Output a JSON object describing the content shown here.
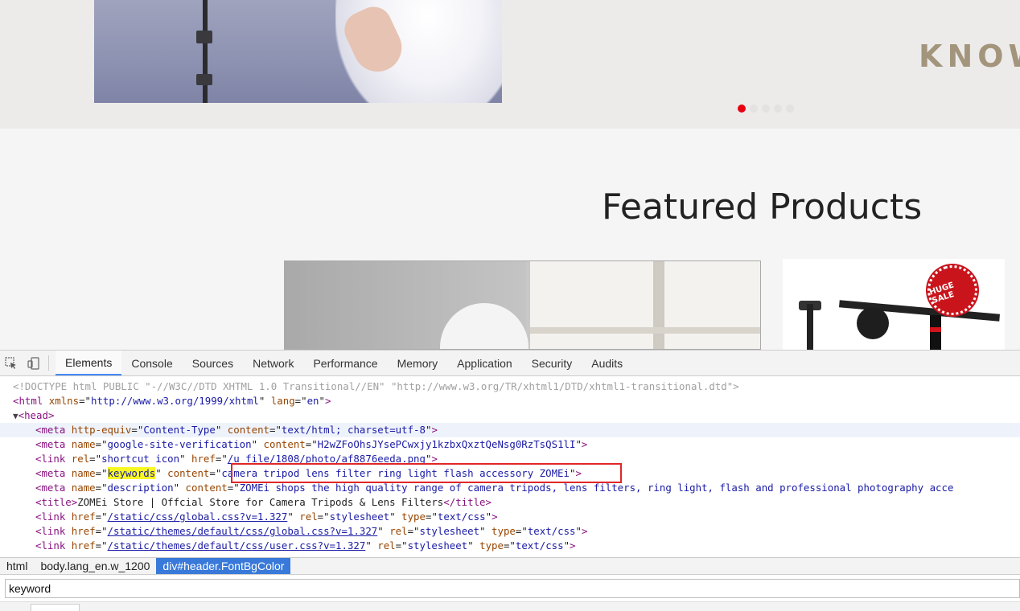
{
  "website": {
    "banner_text": "KNOW",
    "carousel_count": 5,
    "carousel_active": 1,
    "featured_title": "Featured Products",
    "badge_text": "HUGE SALE"
  },
  "devtools": {
    "tabs": [
      {
        "label": "Elements",
        "active": true
      },
      {
        "label": "Console"
      },
      {
        "label": "Sources"
      },
      {
        "label": "Network"
      },
      {
        "label": "Performance"
      },
      {
        "label": "Memory"
      },
      {
        "label": "Application"
      },
      {
        "label": "Security"
      },
      {
        "label": "Audits"
      }
    ],
    "icons": {
      "inspect": "inspect-element-icon",
      "device": "device-toolbar-icon"
    },
    "code": {
      "doctype": "<!DOCTYPE html PUBLIC \"-//W3C//DTD XHTML 1.0 Transitional//EN\" \"http://www.w3.org/TR/xhtml1/DTD/xhtml1-transitional.dtd\">",
      "html_open": {
        "tag": "html",
        "xmlns": "http://www.w3.org/1999/xhtml",
        "lang": "en"
      },
      "head_open": "head",
      "meta_content_type": {
        "http_equiv": "Content-Type",
        "content": "text/html; charset=utf-8"
      },
      "meta_verification": {
        "name": "google-site-verification",
        "content": "H2wZFoOhsJYsePCwxjy1kzbxQxztQeNsg0RzTsQS1lI"
      },
      "link_icon": {
        "rel": "shortcut icon",
        "href": "/u_file/1808/photo/af8876eeda.png"
      },
      "meta_keywords": {
        "name": "keywords",
        "content": "camera tripod lens filter ring light flash accessory ZOMEi"
      },
      "meta_description": {
        "name": "description",
        "content": "ZOMEi shops the high quality range of camera tripods, lens filters, ring light, flash and professional photography acce"
      },
      "title": "ZOMEi Store | Offcial Store for Camera Tripods & Lens Filters",
      "links": [
        {
          "href": "/static/css/global.css?v=1.327",
          "rel": "stylesheet",
          "type": "text/css"
        },
        {
          "href": "/static/themes/default/css/global.css?v=1.327",
          "rel": "stylesheet",
          "type": "text/css"
        },
        {
          "href": "/static/themes/default/css/user.css?v=1.327",
          "rel": "stylesheet",
          "type": "text/css"
        }
      ]
    },
    "breadcrumbs": [
      {
        "label": "html"
      },
      {
        "label": "body.lang_en.w_1200"
      },
      {
        "label": "div#header.FontBgColor",
        "active": true
      }
    ],
    "search_value": "keyword"
  },
  "colors": {
    "accent": "#4a8af4",
    "selected_crumb": "#3879d9",
    "highlight_box": "#e02727",
    "carousel_active": "#e60012"
  }
}
